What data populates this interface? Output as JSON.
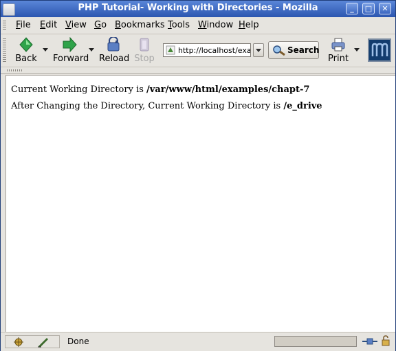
{
  "window": {
    "title": "PHP Tutorial- Working with Directories - Mozilla",
    "controls": {
      "minimize": "_",
      "maximize": "□",
      "close": "✕"
    }
  },
  "menu": [
    {
      "label": "File",
      "u": "F",
      "rest": "ile"
    },
    {
      "label": "Edit",
      "u": "E",
      "rest": "dit"
    },
    {
      "label": "View",
      "u": "V",
      "rest": "iew"
    },
    {
      "label": "Go",
      "u": "G",
      "rest": "o"
    },
    {
      "label": "Bookmarks",
      "u": "B",
      "rest": "ookmarks"
    },
    {
      "label": "Tools",
      "u": "T",
      "rest": "ools"
    },
    {
      "label": "Window",
      "u": "W",
      "rest": "indow"
    },
    {
      "label": "Help",
      "u": "H",
      "rest": "elp"
    }
  ],
  "toolbar": {
    "back": "Back",
    "forward": "Forward",
    "reload": "Reload",
    "stop": "Stop",
    "url": "http://localhost/exa",
    "search": "Search",
    "print": "Print"
  },
  "content": {
    "line1_prefix": "Current Working Directory is ",
    "line1_value": "/var/www/html/examples/chapt-7",
    "line2_prefix": "After Changing the Directory, Current Working Directory is ",
    "line2_value": "/e_drive"
  },
  "status": {
    "text": "Done"
  },
  "colors": {
    "titlebar": "#2b56b0",
    "chrome": "#e6e4df"
  }
}
